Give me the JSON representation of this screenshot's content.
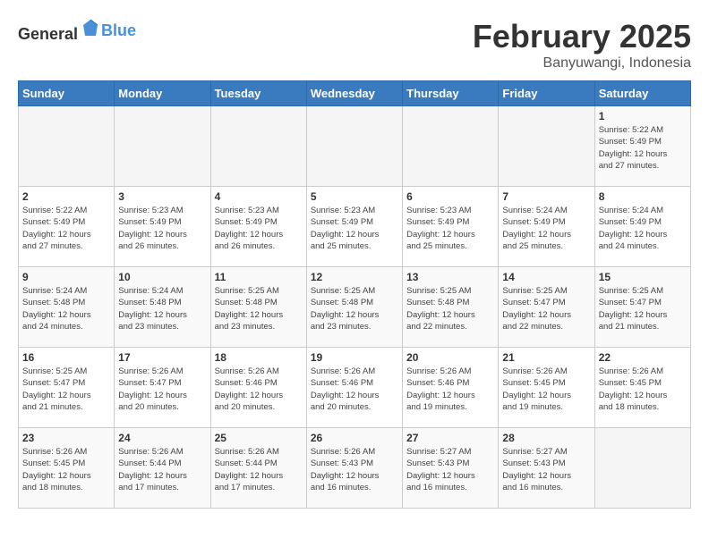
{
  "header": {
    "logo_general": "General",
    "logo_blue": "Blue",
    "title": "February 2025",
    "subtitle": "Banyuwangi, Indonesia"
  },
  "weekdays": [
    "Sunday",
    "Monday",
    "Tuesday",
    "Wednesday",
    "Thursday",
    "Friday",
    "Saturday"
  ],
  "weeks": [
    [
      {
        "day": "",
        "info": ""
      },
      {
        "day": "",
        "info": ""
      },
      {
        "day": "",
        "info": ""
      },
      {
        "day": "",
        "info": ""
      },
      {
        "day": "",
        "info": ""
      },
      {
        "day": "",
        "info": ""
      },
      {
        "day": "1",
        "info": "Sunrise: 5:22 AM\nSunset: 5:49 PM\nDaylight: 12 hours\nand 27 minutes."
      }
    ],
    [
      {
        "day": "2",
        "info": "Sunrise: 5:22 AM\nSunset: 5:49 PM\nDaylight: 12 hours\nand 27 minutes."
      },
      {
        "day": "3",
        "info": "Sunrise: 5:23 AM\nSunset: 5:49 PM\nDaylight: 12 hours\nand 26 minutes."
      },
      {
        "day": "4",
        "info": "Sunrise: 5:23 AM\nSunset: 5:49 PM\nDaylight: 12 hours\nand 26 minutes."
      },
      {
        "day": "5",
        "info": "Sunrise: 5:23 AM\nSunset: 5:49 PM\nDaylight: 12 hours\nand 25 minutes."
      },
      {
        "day": "6",
        "info": "Sunrise: 5:23 AM\nSunset: 5:49 PM\nDaylight: 12 hours\nand 25 minutes."
      },
      {
        "day": "7",
        "info": "Sunrise: 5:24 AM\nSunset: 5:49 PM\nDaylight: 12 hours\nand 25 minutes."
      },
      {
        "day": "8",
        "info": "Sunrise: 5:24 AM\nSunset: 5:49 PM\nDaylight: 12 hours\nand 24 minutes."
      }
    ],
    [
      {
        "day": "9",
        "info": "Sunrise: 5:24 AM\nSunset: 5:48 PM\nDaylight: 12 hours\nand 24 minutes."
      },
      {
        "day": "10",
        "info": "Sunrise: 5:24 AM\nSunset: 5:48 PM\nDaylight: 12 hours\nand 23 minutes."
      },
      {
        "day": "11",
        "info": "Sunrise: 5:25 AM\nSunset: 5:48 PM\nDaylight: 12 hours\nand 23 minutes."
      },
      {
        "day": "12",
        "info": "Sunrise: 5:25 AM\nSunset: 5:48 PM\nDaylight: 12 hours\nand 23 minutes."
      },
      {
        "day": "13",
        "info": "Sunrise: 5:25 AM\nSunset: 5:48 PM\nDaylight: 12 hours\nand 22 minutes."
      },
      {
        "day": "14",
        "info": "Sunrise: 5:25 AM\nSunset: 5:47 PM\nDaylight: 12 hours\nand 22 minutes."
      },
      {
        "day": "15",
        "info": "Sunrise: 5:25 AM\nSunset: 5:47 PM\nDaylight: 12 hours\nand 21 minutes."
      }
    ],
    [
      {
        "day": "16",
        "info": "Sunrise: 5:25 AM\nSunset: 5:47 PM\nDaylight: 12 hours\nand 21 minutes."
      },
      {
        "day": "17",
        "info": "Sunrise: 5:26 AM\nSunset: 5:47 PM\nDaylight: 12 hours\nand 20 minutes."
      },
      {
        "day": "18",
        "info": "Sunrise: 5:26 AM\nSunset: 5:46 PM\nDaylight: 12 hours\nand 20 minutes."
      },
      {
        "day": "19",
        "info": "Sunrise: 5:26 AM\nSunset: 5:46 PM\nDaylight: 12 hours\nand 20 minutes."
      },
      {
        "day": "20",
        "info": "Sunrise: 5:26 AM\nSunset: 5:46 PM\nDaylight: 12 hours\nand 19 minutes."
      },
      {
        "day": "21",
        "info": "Sunrise: 5:26 AM\nSunset: 5:45 PM\nDaylight: 12 hours\nand 19 minutes."
      },
      {
        "day": "22",
        "info": "Sunrise: 5:26 AM\nSunset: 5:45 PM\nDaylight: 12 hours\nand 18 minutes."
      }
    ],
    [
      {
        "day": "23",
        "info": "Sunrise: 5:26 AM\nSunset: 5:45 PM\nDaylight: 12 hours\nand 18 minutes."
      },
      {
        "day": "24",
        "info": "Sunrise: 5:26 AM\nSunset: 5:44 PM\nDaylight: 12 hours\nand 17 minutes."
      },
      {
        "day": "25",
        "info": "Sunrise: 5:26 AM\nSunset: 5:44 PM\nDaylight: 12 hours\nand 17 minutes."
      },
      {
        "day": "26",
        "info": "Sunrise: 5:26 AM\nSunset: 5:43 PM\nDaylight: 12 hours\nand 16 minutes."
      },
      {
        "day": "27",
        "info": "Sunrise: 5:27 AM\nSunset: 5:43 PM\nDaylight: 12 hours\nand 16 minutes."
      },
      {
        "day": "28",
        "info": "Sunrise: 5:27 AM\nSunset: 5:43 PM\nDaylight: 12 hours\nand 16 minutes."
      },
      {
        "day": "",
        "info": ""
      }
    ]
  ]
}
